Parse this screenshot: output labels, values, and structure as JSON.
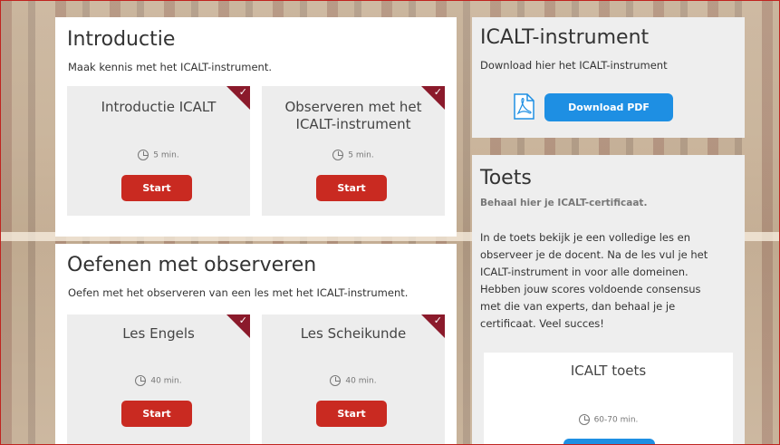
{
  "intro": {
    "title": "Introductie",
    "subtitle": "Maak kennis met het ICALT-instrument.",
    "cards": [
      {
        "title": "Introductie ICALT",
        "duration": "5 min.",
        "button": "Start"
      },
      {
        "title": "Observeren met het ICALT-instrument",
        "duration": "5 min.",
        "button": "Start"
      }
    ]
  },
  "practice": {
    "title": "Oefenen met observeren",
    "subtitle": "Oefen met het observeren van een les met het ICALT-instrument.",
    "cards": [
      {
        "title": "Les Engels",
        "duration": "40 min.",
        "button": "Start"
      },
      {
        "title": "Les Scheikunde",
        "duration": "40 min.",
        "button": "Start"
      }
    ]
  },
  "instrument": {
    "title": "ICALT-instrument",
    "subtitle": "Download hier het ICALT-instrument",
    "download_label": "Download PDF"
  },
  "test": {
    "title": "Toets",
    "subtitle": "Behaal hier je ICALT-certificaat.",
    "paragraph_lines": [
      "In de toets bekijk je een volledige les en",
      "observeer je de docent. Na de les vul je het",
      "ICALT-instrument in voor alle domeinen.",
      "Hebben jouw scores voldoende consensus",
      "met die van experts, dan behaal je je",
      "certificaat. Veel succes!"
    ],
    "card": {
      "title": "ICALT toets",
      "duration": "60-70 min."
    }
  },
  "icons": {
    "clock": "clock-icon",
    "pdf": "pdf-icon",
    "check": "checkmark-icon"
  },
  "colors": {
    "start_button": "#c92a21",
    "download_button": "#1e8fe3",
    "ribbon": "#8b1a2b"
  }
}
